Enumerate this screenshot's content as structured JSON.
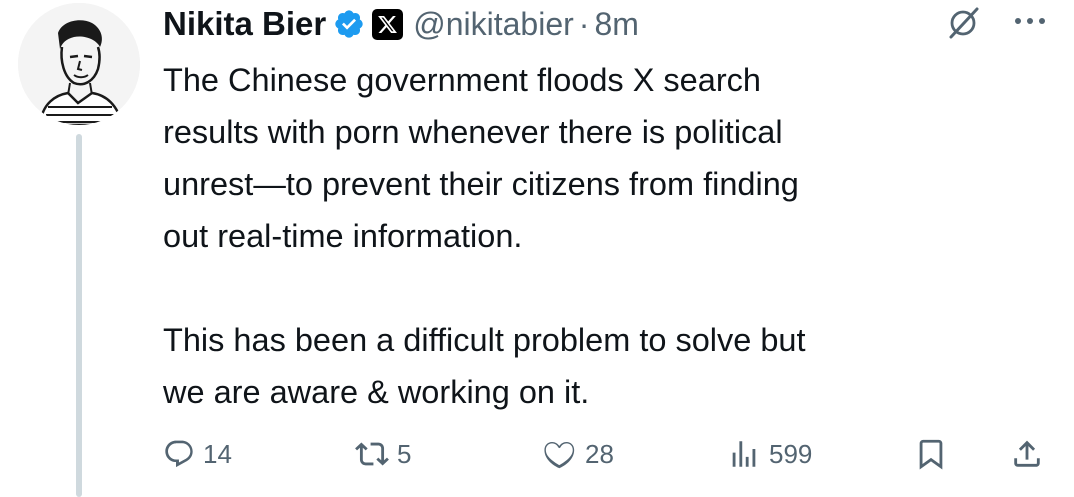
{
  "author": {
    "name": "Nikita Bier",
    "handle": "@nikitabier",
    "separator": "·",
    "time": "8m",
    "verified_color": "#1d9bf0",
    "avatar_icon": "sketched-portrait-avatar",
    "badge_icon": "x-logo-badge"
  },
  "tweet": {
    "paragraphs": [
      "The Chinese government floods X search\nresults with porn whenever there is political\nunrest—to prevent their citizens from finding\nout real-time information.",
      "This has been a difficult problem to solve but\nwe are aware & working on it."
    ]
  },
  "actions": {
    "replies": "14",
    "reposts": "5",
    "likes": "28",
    "views": "599"
  },
  "colors": {
    "text": "#0f1419",
    "secondary": "#536471",
    "thread_line": "#cfd9de"
  }
}
